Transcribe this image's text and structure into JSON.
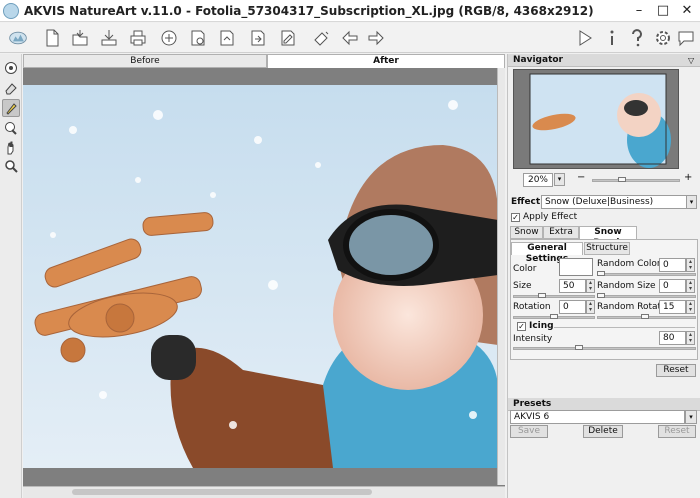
{
  "titlebar": {
    "title": "AKVIS NatureArt v.11.0 - Fotolia_57304317_Subscription_XL.jpg (RGB/8, 4368x2912)",
    "minimize": "–",
    "maximize": "□",
    "close": "✕"
  },
  "toolbar": {
    "left_icons": [
      "new-icon",
      "open-icon",
      "save-icon",
      "print-icon",
      "share-icon",
      "batch-icon",
      "plugin-icon",
      "export-icon",
      "import-icon",
      "paint-icon",
      "undo-icon",
      "redo-icon"
    ],
    "right_icons": [
      "run-icon",
      "info-icon",
      "help-icon",
      "settings-icon",
      "feedback-icon"
    ]
  },
  "tabs": {
    "before": "Before",
    "after": "After"
  },
  "navigator": {
    "title": "Navigator",
    "zoom": "20%",
    "zoom_out": "−",
    "zoom_in": "+"
  },
  "effect": {
    "label": "Effect:",
    "value": "Snow (Deluxe|Business)",
    "apply_label": "Apply Effect",
    "apply_checked": true
  },
  "effect_tabs": [
    "Snow",
    "Extra",
    "Snow Brush"
  ],
  "brush_tabs": [
    "General Settings",
    "Structure"
  ],
  "settings": {
    "color_label": "Color",
    "random_color_label": "Random Color",
    "random_color_value": "0",
    "size_label": "Size",
    "size_value": "50",
    "random_size_label": "Random Size",
    "random_size_value": "0",
    "rotation_label": "Rotation",
    "rotation_value": "0",
    "random_rotation_label": "Random Rotation",
    "random_rotation_value": "15",
    "icing_label": "Icing",
    "icing_checked": true,
    "intensity_label": "Intensity",
    "intensity_value": "80",
    "reset_label": "Reset"
  },
  "presets": {
    "title": "Presets",
    "value": "AKVIS 6",
    "save_label": "Save",
    "delete_label": "Delete",
    "reset_label": "Reset"
  },
  "colors": {
    "sky": "#cfe3f2",
    "scarf": "#4aa7cf",
    "jacket": "#8a4a2a",
    "plane": "#d98a4e"
  }
}
